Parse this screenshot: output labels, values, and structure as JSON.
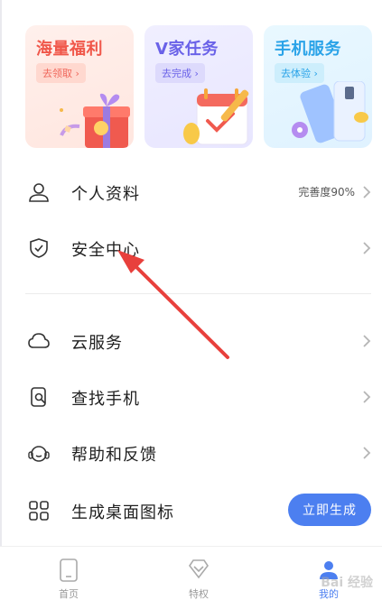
{
  "cards": [
    {
      "title": "海量福利",
      "action": "去领取 ›"
    },
    {
      "title": "V家任务",
      "action": "去完成 ›"
    },
    {
      "title": "手机服务",
      "action": "去体验 ›"
    }
  ],
  "menu": [
    {
      "label": "个人资料",
      "value": "完善度90%",
      "icon": "person-icon"
    },
    {
      "label": "安全中心",
      "icon": "shield-icon"
    },
    {
      "label": "云服务",
      "icon": "cloud-icon"
    },
    {
      "label": "查找手机",
      "icon": "find-phone-icon"
    },
    {
      "label": "帮助和反馈",
      "icon": "headset-icon"
    },
    {
      "label": "生成桌面图标",
      "button": "立即生成",
      "icon": "grid-icon"
    }
  ],
  "nav": [
    {
      "label": "首页",
      "icon": "phone-home-icon"
    },
    {
      "label": "特权",
      "icon": "diamond-icon"
    },
    {
      "label": "我的",
      "icon": "profile-icon"
    }
  ],
  "watermark": "Bai 经验",
  "colors": {
    "accent": "#4c7ff0",
    "arrow": "#e8403c"
  }
}
